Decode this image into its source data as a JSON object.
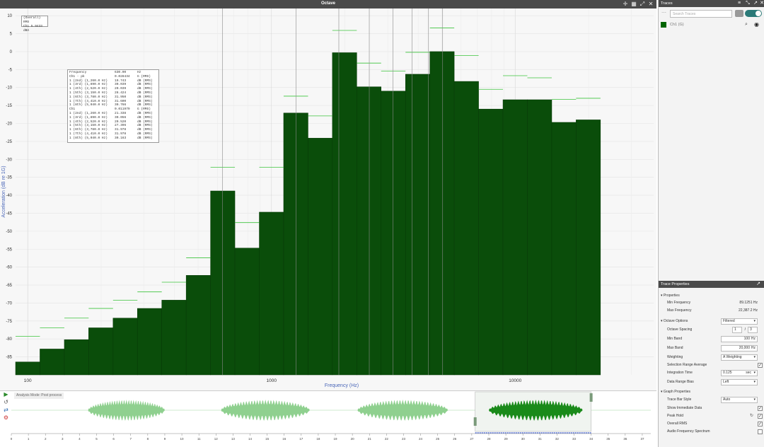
{
  "window": {
    "title": "Octave"
  },
  "chart_legend": [
    "(Overall) RMS",
    "Ch1  5.9433  dBA"
  ],
  "measurement_table": [
    [
      "Frequency",
      "630.00",
      "Hz"
    ],
    [
      "Ch1 - pk",
      "0.028434",
      "G (RMS)"
    ],
    [
      "1 (2nd) (1,260.0 Hz)",
      "19.743",
      "dB (RMS)"
    ],
    [
      "1 (3rd) (1,890.0 Hz)",
      "30.039",
      "dB (RMS)"
    ],
    [
      "1 (4th) (2,520.0 Hz)",
      "20.039",
      "dB (RMS)"
    ],
    [
      "1 (5th) (3,150.0 Hz)",
      "28.424",
      "dB (RMS)"
    ],
    [
      "1 (6th) (3,780.0 Hz)",
      "31.950",
      "dB (RMS)"
    ],
    [
      "1 (7th) (4,410.0 Hz)",
      "31.600",
      "dB (RMS)"
    ],
    [
      "1 (8th) (5,040.0 Hz)",
      "30.766",
      "dB (RMS)"
    ],
    [
      "Ch1",
      "0.011979",
      "G (RMS)"
    ],
    [
      "1 (2nd) (1,260.0 Hz)",
      "21.338",
      "dB (RMS)"
    ],
    [
      "1 (3rd) (1,890.0 Hz)",
      "30.056",
      "dB (RMS)"
    ],
    [
      "1 (4th) (2,520.0 Hz)",
      "20.520",
      "dB (RMS)"
    ],
    [
      "1 (5th) (3,150.0 Hz)",
      "27.396",
      "dB (RMS)"
    ],
    [
      "1 (6th) (3,780.0 Hz)",
      "31.978",
      "dB (RMS)"
    ],
    [
      "1 (7th) (4,410.0 Hz)",
      "31.978",
      "dB (RMS)"
    ],
    [
      "1 (8th) (5,040.0 Hz)",
      "30.163",
      "dB (RMS)"
    ]
  ],
  "chart_data": {
    "type": "bar",
    "xlabel": "Frequency (Hz)",
    "ylabel": "Acceleration (dB re 1G)",
    "xscale": "log",
    "xlim": [
      89.1251,
      37000
    ],
    "ylim": [
      -90,
      12
    ],
    "x_ticks": [
      "100",
      "1000",
      "10000"
    ],
    "y_ticks": [
      10,
      5,
      0,
      -5,
      -10,
      -15,
      -20,
      -25,
      -30,
      -35,
      -40,
      -45,
      -50,
      -55,
      -60,
      -65,
      -70,
      -75,
      -80,
      -85
    ],
    "bar_edges": [
      89.1251,
      112.2,
      141.3,
      177.8,
      223.9,
      281.8,
      354.8,
      446.7,
      562.3,
      707.9,
      891.3,
      1122,
      1413,
      1778,
      2239,
      2818,
      3548,
      4467,
      5623,
      7079,
      8913,
      11220,
      14130,
      17780,
      22387.2
    ],
    "bars": [
      -86.4,
      -82.8,
      -80.2,
      -76.9,
      -74.2,
      -71.5,
      -69.2,
      -62.3,
      -38.8,
      -54.7,
      -44.7,
      -17.1,
      -24.1,
      -0.3,
      -9.8,
      -11,
      -6.3,
      0,
      -8.3,
      -16,
      -13.4,
      -13.4,
      -19.7,
      -19
    ],
    "peak_hold": [
      -79.3,
      -76.9,
      -74.2,
      -71.5,
      -69.2,
      -66.9,
      -64.2,
      -57.4,
      -32.2,
      -47.6,
      -32.2,
      -12.4,
      -17.9,
      5.9,
      -3.2,
      -5.4,
      -0.2,
      6.6,
      -1.1,
      -10.5,
      -6.7,
      -7.3,
      -13.3,
      -13
    ]
  },
  "waveform": {
    "mode_label": "Analysis Mode: Post process",
    "time_ticks": [
      "0",
      "1",
      "2",
      "3",
      "4",
      "5",
      "6",
      "7",
      "8",
      "9",
      "10",
      "11",
      "12",
      "13",
      "14",
      "15",
      "16",
      "17",
      "18",
      "19",
      "20",
      "21",
      "22",
      "23",
      "24",
      "25",
      "26",
      "27",
      "28",
      "29",
      "30",
      "31",
      "32",
      "33",
      "34",
      "35",
      "36",
      "37"
    ],
    "selection": [
      27.2,
      34
    ]
  },
  "traces_panel": {
    "title": "Traces",
    "search_placeholder": "Search Traces",
    "trace_name": "Ch1 (G)",
    "trace_color": "#006400"
  },
  "trace_properties": {
    "title": "Trace Properties",
    "properties_header": "Properties",
    "min_frequency_label": "Min Frequency",
    "min_frequency_value": "89.1251 Hz",
    "max_frequency_label": "Max Frequency",
    "max_frequency_value": "22,387.2 Hz",
    "octave_header": "Octave Options",
    "octave_mode": "Filtered",
    "octave_spacing_label": "Octave Spacing",
    "octave_spacing_num": "1",
    "octave_spacing_den": "3",
    "min_band_label": "Min Band",
    "min_band_value": "100",
    "min_band_unit": "Hz",
    "max_band_label": "Max Band",
    "max_band_value": "20,000",
    "max_band_unit": "Hz",
    "weighting_label": "Weighting",
    "weighting_value": "A Weighting",
    "selection_avg_label": "Selection Range Average",
    "integration_label": "Integration Time",
    "integration_value": "0.125",
    "integration_unit": "sec",
    "data_range_label": "Data Range Bias",
    "data_range_value": "Left",
    "graph_header": "Graph Properties",
    "trace_bar_label": "Trace Bar Style",
    "trace_bar_value": "Auto",
    "show_immediate_label": "Show Immediate Data",
    "peak_hold_label": "Peak Hold",
    "overall_rms_label": "Overall RMS",
    "audio_freq_label": "Audio Frequency Spectrum"
  }
}
